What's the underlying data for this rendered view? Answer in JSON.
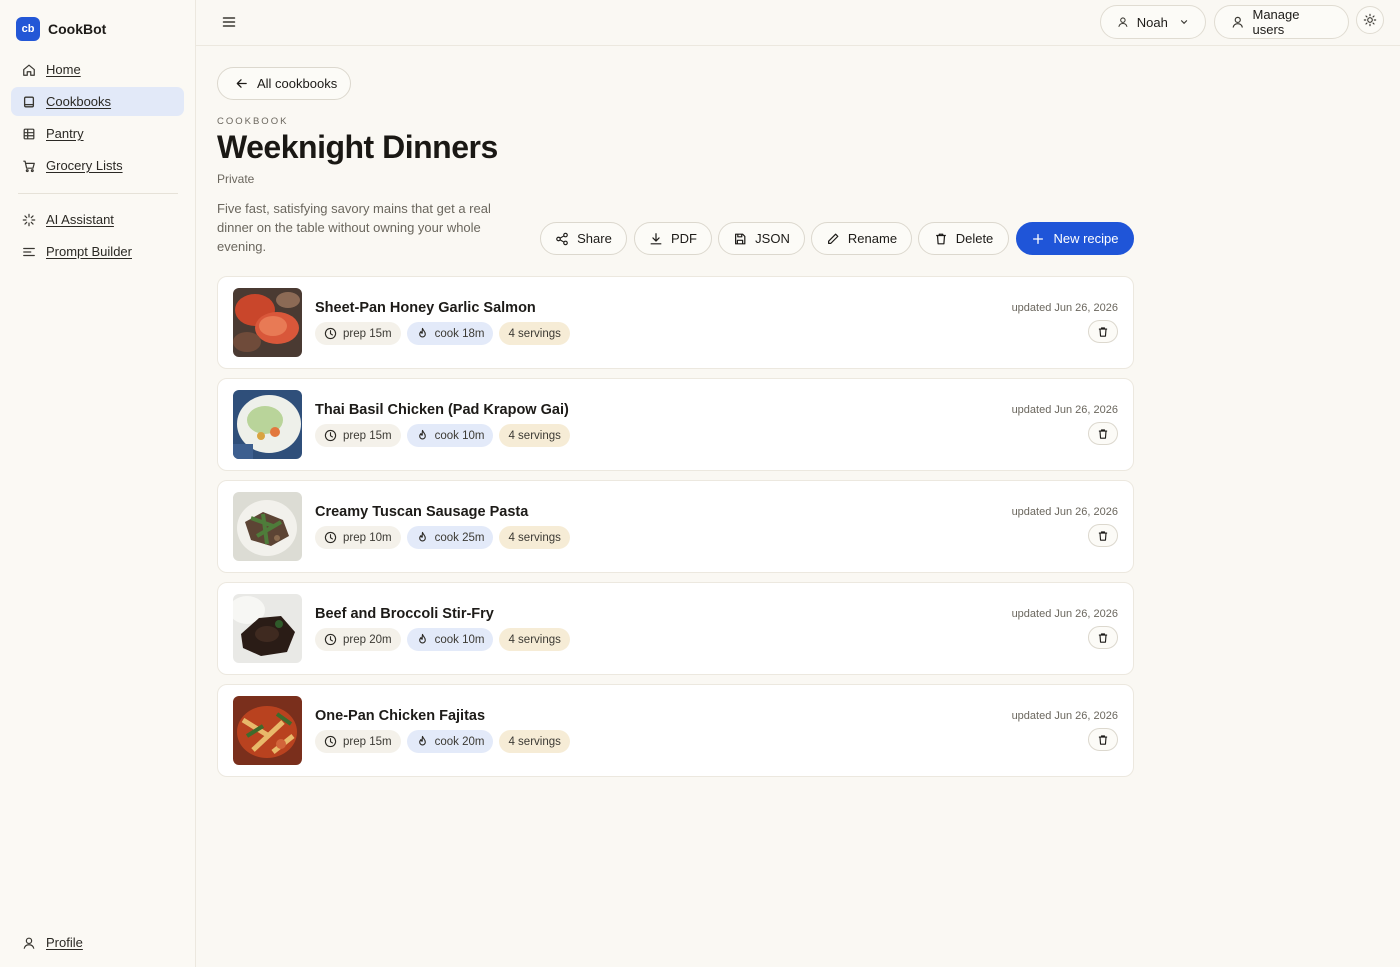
{
  "brand": {
    "logo": "cb",
    "name": "CookBot",
    "accent": "#2357d6"
  },
  "nav": {
    "items": [
      {
        "label": "Home",
        "icon": "home-icon"
      },
      {
        "label": "Cookbooks",
        "icon": "book-icon",
        "active": true
      },
      {
        "label": "Pantry",
        "icon": "grid-icon"
      },
      {
        "label": "Grocery Lists",
        "icon": "cart-icon"
      },
      {
        "label": "AI Assistant",
        "icon": "sparkle-icon"
      },
      {
        "label": "Prompt Builder",
        "icon": "lines-icon"
      }
    ],
    "profile": "Profile"
  },
  "topbar": {
    "user": "Noah",
    "manage_users": "Manage users"
  },
  "page": {
    "back_label": "All cookbooks",
    "eyebrow": "COOKBOOK",
    "title": "Weeknight Dinners",
    "visibility": "Private",
    "description": "Five fast, satisfying savory mains that get a real dinner on the table without owning your whole evening."
  },
  "actions": {
    "share": "Share",
    "pdf": "PDF",
    "json": "JSON",
    "rename": "Rename",
    "delete": "Delete",
    "new_recipe": "New recipe"
  },
  "recipes": [
    {
      "title": "Sheet-Pan Honey Garlic Salmon",
      "prep": "prep 15m",
      "cook": "cook 18m",
      "servings": "4 servings",
      "updated": "updated Jun 26, 2026"
    },
    {
      "title": "Thai Basil Chicken (Pad Krapow Gai)",
      "prep": "prep 15m",
      "cook": "cook 10m",
      "servings": "4 servings",
      "updated": "updated Jun 26, 2026"
    },
    {
      "title": "Creamy Tuscan Sausage Pasta",
      "prep": "prep 10m",
      "cook": "cook 25m",
      "servings": "4 servings",
      "updated": "updated Jun 26, 2026"
    },
    {
      "title": "Beef and Broccoli Stir-Fry",
      "prep": "prep 20m",
      "cook": "cook 10m",
      "servings": "4 servings",
      "updated": "updated Jun 26, 2026"
    },
    {
      "title": "One-Pan Chicken Fajitas",
      "prep": "prep 15m",
      "cook": "cook 20m",
      "servings": "4 servings",
      "updated": "updated Jun 26, 2026"
    }
  ]
}
